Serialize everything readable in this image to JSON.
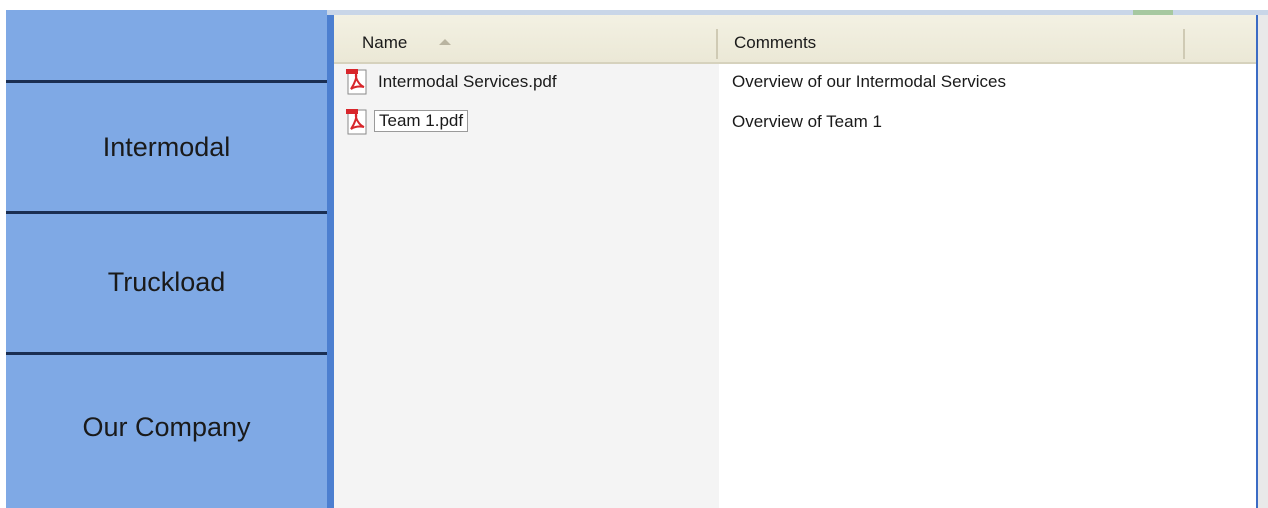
{
  "sidebar": {
    "items": [
      {
        "label": "Intermodal"
      },
      {
        "label": "Truckload"
      },
      {
        "label": "Our Company"
      }
    ]
  },
  "explorer": {
    "columns": {
      "name": "Name",
      "comments": "Comments"
    },
    "sort": {
      "column": "Name",
      "direction": "ascending"
    },
    "files": [
      {
        "name": "Intermodal Services.pdf",
        "comment": "Overview of our Intermodal Services",
        "icon": "pdf-icon"
      },
      {
        "name": "Team 1.pdf",
        "comment": "Overview of Team 1",
        "icon": "pdf-icon"
      }
    ]
  },
  "colors": {
    "sidebar": "#7fa9e5",
    "divider": "#1a2e52",
    "frame": "#4c7fd0",
    "pdf_red": "#d8262b"
  }
}
